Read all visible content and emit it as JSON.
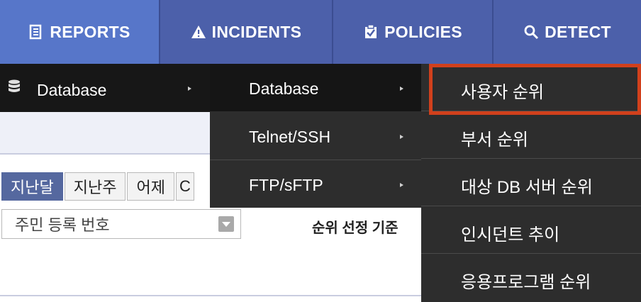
{
  "topnav": {
    "tabs": [
      {
        "label": "REPORTS",
        "icon": "report-icon",
        "active": true
      },
      {
        "label": "INCIDENTS",
        "icon": "warning-icon",
        "active": false
      },
      {
        "label": "POLICIES",
        "icon": "clipboard-check-icon",
        "active": false
      },
      {
        "label": "DETECT",
        "icon": "search-icon",
        "active": false
      }
    ]
  },
  "menu": {
    "level1": {
      "label": "Database",
      "icon": "database-icon"
    },
    "level2": [
      {
        "label": "Database"
      },
      {
        "label": "Telnet/SSH"
      },
      {
        "label": "FTP/sFTP"
      }
    ],
    "level3": [
      {
        "label": "사용자 순위"
      },
      {
        "label": "부서 순위"
      },
      {
        "label": "대상 DB 서버 순위"
      },
      {
        "label": "인시던트 추이"
      },
      {
        "label": "응용프로그램 순위"
      }
    ]
  },
  "filters": {
    "period_tabs": [
      "지난달",
      "지난주",
      "어제"
    ],
    "period_tab_partial": "C",
    "select_value": "주민 등록 번호",
    "criteria_label": "순위 선정 기준"
  },
  "colors": {
    "nav_bg": "#4c60aa",
    "nav_active": "#5776c9",
    "menu_bg": "#2d2d2d",
    "highlight": "#d1401c"
  }
}
